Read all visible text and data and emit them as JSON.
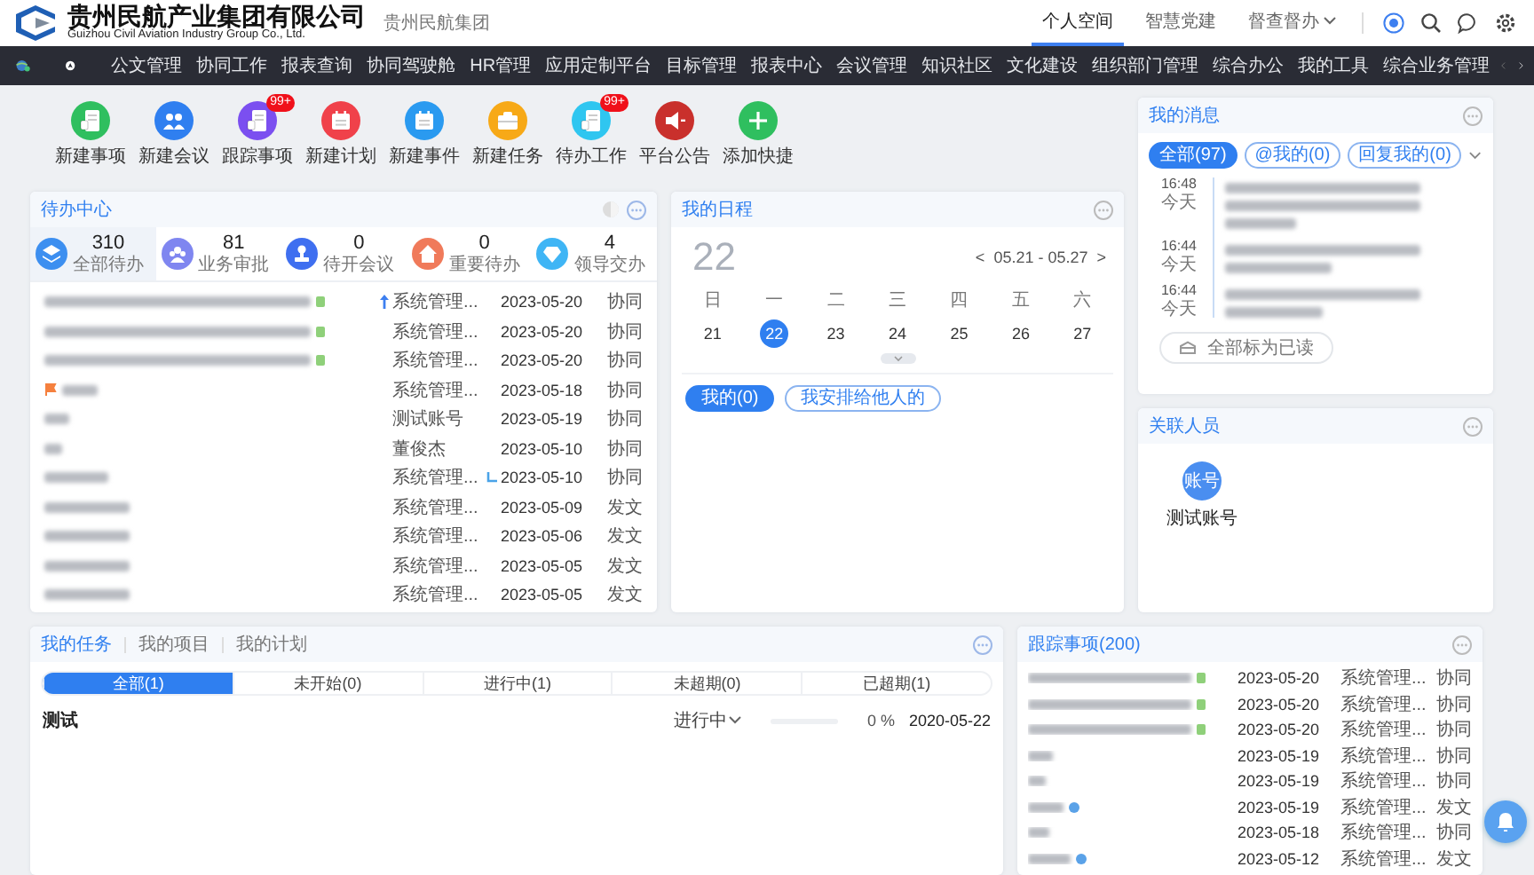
{
  "header": {
    "logo_title": "贵州民航产业集团有限公司",
    "logo_subtitle": "Guizhou Civil Aviation Industry Group Co., Ltd.",
    "org_name": "贵州民航集团",
    "tabs": [
      {
        "label": "个人空间",
        "selected": true,
        "dropdown": false
      },
      {
        "label": "智慧党建",
        "selected": false,
        "dropdown": false
      },
      {
        "label": "督查督办",
        "selected": false,
        "dropdown": true
      }
    ]
  },
  "nav": {
    "items": [
      "公文管理",
      "协同工作",
      "报表查询",
      "协同驾驶舱",
      "HR管理",
      "应用定制平台",
      "目标管理",
      "报表中心",
      "会议管理",
      "知识社区",
      "文化建设",
      "组织部门管理",
      "综合办公",
      "我的工具",
      "综合业务管理"
    ]
  },
  "quick_actions": [
    {
      "label": "新建事项",
      "color": "#2fbf5f"
    },
    {
      "label": "新建会议",
      "color": "#2f7ff0"
    },
    {
      "label": "跟踪事项",
      "color": "#7b4ff0",
      "badge": "99+"
    },
    {
      "label": "新建计划",
      "color": "#f0414a"
    },
    {
      "label": "新建事件",
      "color": "#2a9af0"
    },
    {
      "label": "新建任务",
      "color": "#f7a917"
    },
    {
      "label": "待办工作",
      "color": "#2fc6f0",
      "badge": "99+"
    },
    {
      "label": "平台公告",
      "color": "#c9302c"
    },
    {
      "label": "添加快捷",
      "color": "#2fbf5f"
    }
  ],
  "todo": {
    "title": "待办中心",
    "stats": [
      {
        "value": "310",
        "label": "全部待办",
        "color": "#3d8ff0",
        "selected": true
      },
      {
        "value": "81",
        "label": "业务审批",
        "color": "#7f86f0",
        "selected": false
      },
      {
        "value": "0",
        "label": "待开会议",
        "color": "#3f6ff0",
        "selected": false
      },
      {
        "value": "0",
        "label": "重要待办",
        "color": "#f07a5a",
        "selected": false
      },
      {
        "value": "4",
        "label": "领导交办",
        "color": "#3fb5f5",
        "selected": false
      }
    ],
    "rows": [
      {
        "tagged": true,
        "flagged": false,
        "pinned": true,
        "linked": false,
        "sender": "系统管理...",
        "date": "2023-05-20",
        "type": "协同"
      },
      {
        "tagged": true,
        "flagged": false,
        "pinned": false,
        "linked": false,
        "sender": "系统管理...",
        "date": "2023-05-20",
        "type": "协同"
      },
      {
        "tagged": true,
        "flagged": false,
        "pinned": false,
        "linked": false,
        "sender": "系统管理...",
        "date": "2023-05-20",
        "type": "协同"
      },
      {
        "tagged": false,
        "flagged": true,
        "pinned": false,
        "linked": false,
        "sender": "系统管理...",
        "date": "2023-05-18",
        "type": "协同"
      },
      {
        "tagged": false,
        "flagged": false,
        "pinned": false,
        "linked": false,
        "sender": "测试账号",
        "date": "2023-05-19",
        "type": "协同"
      },
      {
        "tagged": false,
        "flagged": false,
        "pinned": false,
        "linked": false,
        "sender": "董俊杰",
        "date": "2023-05-10",
        "type": "协同"
      },
      {
        "tagged": false,
        "flagged": false,
        "pinned": false,
        "linked": true,
        "sender": "系统管理...",
        "date": "2023-05-10",
        "type": "协同"
      },
      {
        "tagged": false,
        "flagged": false,
        "pinned": false,
        "linked": false,
        "sender": "系统管理...",
        "date": "2023-05-09",
        "type": "发文"
      },
      {
        "tagged": false,
        "flagged": false,
        "pinned": false,
        "linked": false,
        "sender": "系统管理...",
        "date": "2023-05-06",
        "type": "发文"
      },
      {
        "tagged": false,
        "flagged": false,
        "pinned": false,
        "linked": false,
        "sender": "系统管理...",
        "date": "2023-05-05",
        "type": "发文"
      },
      {
        "tagged": false,
        "flagged": false,
        "pinned": false,
        "linked": false,
        "sender": "系统管理...",
        "date": "2023-05-05",
        "type": "发文"
      }
    ]
  },
  "calendar": {
    "title": "我的日程",
    "big_day": "22",
    "range": "05.21 - 05.27",
    "prev": "<",
    "next": ">",
    "weekdays": [
      "日",
      "一",
      "二",
      "三",
      "四",
      "五",
      "六"
    ],
    "days": [
      {
        "label": "21",
        "selected": false
      },
      {
        "label": "22",
        "selected": true
      },
      {
        "label": "23",
        "selected": false
      },
      {
        "label": "24",
        "selected": false
      },
      {
        "label": "25",
        "selected": false
      },
      {
        "label": "26",
        "selected": false
      },
      {
        "label": "27",
        "selected": false
      }
    ],
    "filters": [
      {
        "label": "我的(0)",
        "selected": true
      },
      {
        "label": "我安排给他人的",
        "selected": false
      }
    ]
  },
  "messages": {
    "title": "我的消息",
    "filters": [
      {
        "label": "全部(97)",
        "selected": true
      },
      {
        "label": "@我的(0)",
        "selected": false
      },
      {
        "label": "回复我的(0)",
        "selected": false
      }
    ],
    "items": [
      {
        "time": "16:48",
        "day": "今天"
      },
      {
        "time": "16:44",
        "day": "今天"
      },
      {
        "time": "16:44",
        "day": "今天"
      }
    ],
    "mark_all": "全部标为已读"
  },
  "related": {
    "title": "关联人员",
    "people": [
      {
        "avatar": "账号",
        "name": "测试账号"
      }
    ]
  },
  "tasks": {
    "tabs": [
      {
        "label": "我的任务",
        "selected": true
      },
      {
        "label": "我的项目",
        "selected": false
      },
      {
        "label": "我的计划",
        "selected": false
      }
    ],
    "filters": [
      {
        "label": "全部(1)",
        "selected": true
      },
      {
        "label": "未开始(0)",
        "selected": false
      },
      {
        "label": "进行中(1)",
        "selected": false
      },
      {
        "label": "未超期(0)",
        "selected": false
      },
      {
        "label": "已超期(1)",
        "selected": false
      }
    ],
    "items": [
      {
        "name": "测试",
        "status": "进行中",
        "level": 0,
        "percent": "0 %",
        "date": "2020-05-22"
      }
    ]
  },
  "tracking": {
    "title": "跟踪事项(200)",
    "rows": [
      {
        "tagged": true,
        "info": false,
        "date": "2023-05-20",
        "sender": "系统管理...",
        "type": "协同"
      },
      {
        "tagged": true,
        "info": false,
        "date": "2023-05-20",
        "sender": "系统管理...",
        "type": "协同"
      },
      {
        "tagged": true,
        "info": false,
        "date": "2023-05-20",
        "sender": "系统管理...",
        "type": "协同"
      },
      {
        "tagged": false,
        "info": false,
        "date": "2023-05-19",
        "sender": "系统管理...",
        "type": "协同"
      },
      {
        "tagged": false,
        "info": false,
        "date": "2023-05-19",
        "sender": "系统管理...",
        "type": "协同"
      },
      {
        "tagged": false,
        "info": true,
        "date": "2023-05-19",
        "sender": "系统管理...",
        "type": "发文"
      },
      {
        "tagged": false,
        "info": false,
        "date": "2023-05-18",
        "sender": "系统管理...",
        "type": "协同"
      },
      {
        "tagged": false,
        "info": true,
        "date": "2023-05-12",
        "sender": "系统管理...",
        "type": "发文"
      }
    ]
  }
}
